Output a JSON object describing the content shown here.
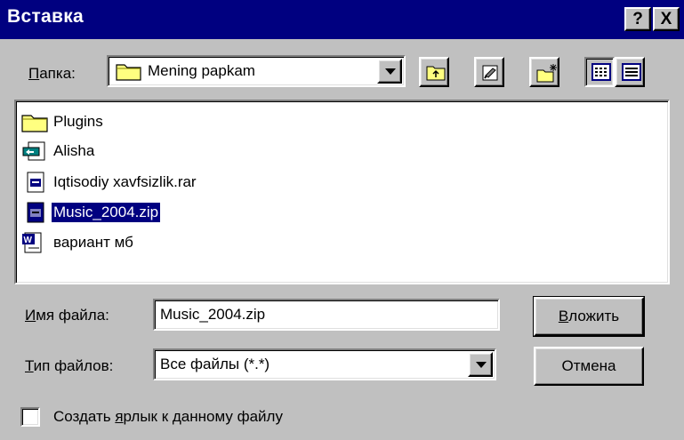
{
  "dialog": {
    "title": "Вставка",
    "help_button": "?",
    "close_button": "X"
  },
  "folder": {
    "label_underlined": "П",
    "label_rest": "апка:",
    "value": "Mening  papkam"
  },
  "toolbar": {
    "items": [
      "up-folder-icon",
      "desktop-icon",
      "new-folder-icon",
      "list-view-icon",
      "details-view-icon"
    ]
  },
  "files": [
    {
      "name": "Plugins",
      "icon": "folder-icon",
      "selected": false
    },
    {
      "name": "Alisha",
      "icon": "shortcut-icon",
      "selected": false
    },
    {
      "name": "Iqtisodiy xavfsizlik.rar",
      "icon": "archive-icon",
      "selected": false
    },
    {
      "name": "Music_2004.zip",
      "icon": "archive-icon",
      "selected": true
    },
    {
      "name": "вариант мб",
      "icon": "word-document-icon",
      "selected": false
    }
  ],
  "filename": {
    "label_underlined": "И",
    "label_rest": "мя файла:",
    "value": "Music_2004.zip"
  },
  "filetype": {
    "label_underlined": "Т",
    "label_rest": "ип файлов:",
    "value": "Все файлы (*.*)"
  },
  "buttons": {
    "insert_underlined": "В",
    "insert_rest": "ложить",
    "cancel": "Отмена"
  },
  "shortcut_checkbox": {
    "label_before": "Создать ",
    "label_underlined": "я",
    "label_after": "рлык к данному файлу",
    "checked": false
  },
  "colors": {
    "title_bar": "#000080",
    "face": "#c0c0c0",
    "selection": "#000080"
  }
}
